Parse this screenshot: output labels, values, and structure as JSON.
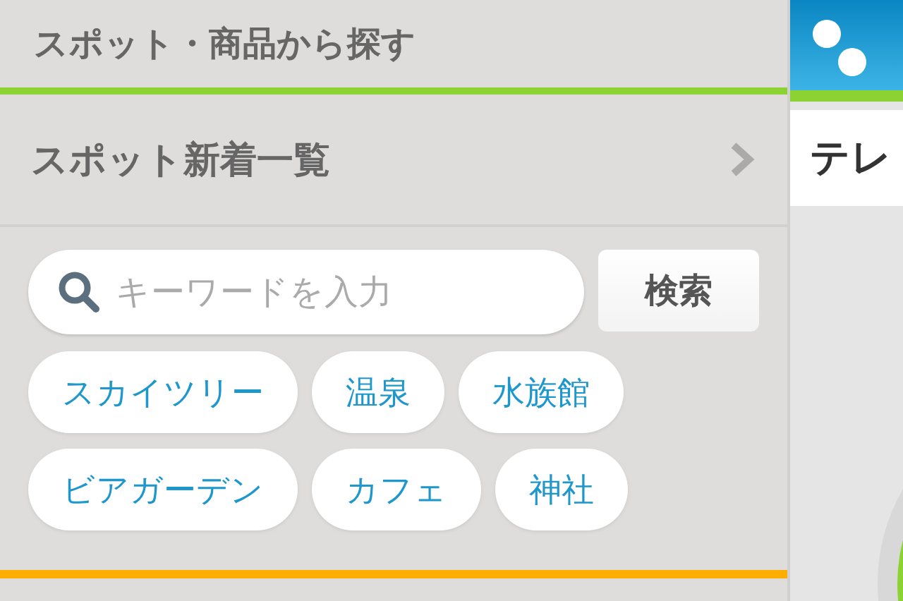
{
  "section_title": "スポット・商品から探す",
  "menu_item": {
    "label": "スポット新着一覧"
  },
  "search": {
    "placeholder": "キーワードを入力",
    "button": "検索"
  },
  "tags": [
    {
      "label": "スカイツリー"
    },
    {
      "label": "温泉"
    },
    {
      "label": "水族館"
    },
    {
      "label": "ビアガーデン"
    },
    {
      "label": "カフェ"
    },
    {
      "label": "神社"
    }
  ],
  "side_panel": {
    "heading": "テレ"
  }
}
